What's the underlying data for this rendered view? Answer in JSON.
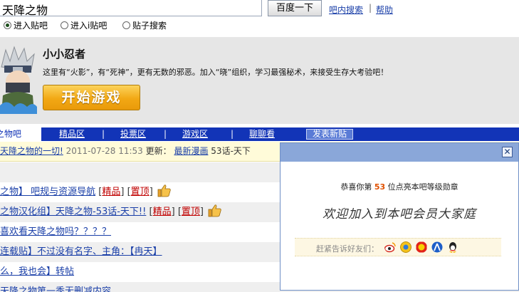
{
  "search": {
    "query": "天降之物",
    "button_label": "百度一下",
    "links": [
      "吧内搜索",
      "帮助"
    ],
    "separator": "|",
    "options": [
      {
        "label": "进入贴吧",
        "selected": true
      },
      {
        "label": "进入i贴吧",
        "selected": false
      },
      {
        "label": "贴子搜索",
        "selected": false
      }
    ]
  },
  "game": {
    "title": "小小忍者",
    "description": "这里有“火影”，有“死神”，更有无数的邪恶。加入“晓”组织，学习最强秘术，来接受生存大考验吧！",
    "start_button": "开始游戏"
  },
  "nav": {
    "active_tab": "之物吧",
    "items": [
      "精品区",
      "投票区",
      "游戏区",
      "聊聊看"
    ],
    "separator": "|",
    "post_button": "发表新贴"
  },
  "announcement": {
    "link_text": "天降之物的一切!",
    "date": "2011-07-28 11:53",
    "update_label": "更新：",
    "latest_label": "最新漫画",
    "latest_text": "53话-天下"
  },
  "threads": [
    {
      "title": "之物】 吧规与资源导航",
      "tags": [
        "精品",
        "置顶"
      ],
      "thumb": true
    },
    {
      "title": "之物汉化组】天降之物-53话-天下!!",
      "tags": [
        "精品",
        "置顶"
      ],
      "thumb": true
    },
    {
      "title": "喜欢看天降之物吗？？？？",
      "tags": [],
      "thumb": false
    },
    {
      "title": "连载贴】不过没有名字、主角：【冉天】",
      "tags": [],
      "thumb": false
    },
    {
      "title": "么，我也会】转帖",
      "tags": [],
      "thumb": false
    },
    {
      "title": "天降之物第一季无删减内容",
      "tags": [],
      "thumb": false
    }
  ],
  "popup": {
    "close_glyph": "✕",
    "congrats_prefix": "恭喜你第",
    "rank_number": "53",
    "congrats_suffix": "位点亮本吧等级勋章",
    "welcome": "欢迎加入到本吧会员大家庭",
    "share_label": "赶紧告诉好友们：",
    "share_icons": [
      "weibo-icon",
      "sohu-icon",
      "kaixin-icon",
      "renren-icon",
      "qq-icon"
    ]
  },
  "colors": {
    "nav_bar": "#1234b7",
    "link": "#1a3fa8",
    "tag_red": "#c00000",
    "start_button": "#f2a814",
    "popup_header": "#8aa7d9"
  }
}
